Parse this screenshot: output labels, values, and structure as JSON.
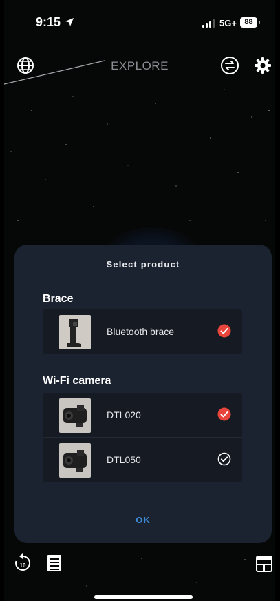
{
  "status_bar": {
    "time": "9:15",
    "network": "5G+",
    "battery": "88"
  },
  "header": {
    "title": "EXPLORE",
    "left_icon": "globe-icon",
    "right_icons": [
      "swap-icon",
      "gear-icon"
    ]
  },
  "dialog": {
    "title": "Select product",
    "sections": [
      {
        "title": "Brace",
        "items": [
          {
            "label": "Bluetooth brace",
            "checked": true
          }
        ]
      },
      {
        "title": "Wi-Fi camera",
        "items": [
          {
            "label": "DTL020",
            "checked": true
          },
          {
            "label": "DTL050",
            "checked": false
          }
        ]
      }
    ],
    "ok_label": "OK"
  },
  "bottom_bar": {
    "icons": [
      "replay-10-icon",
      "notes-icon",
      "layout-icon"
    ]
  },
  "colors": {
    "accent": "#e8453c",
    "ok_blue": "#3b8ad6",
    "dialog_bg": "#1b2230",
    "card_bg": "#151a23"
  }
}
